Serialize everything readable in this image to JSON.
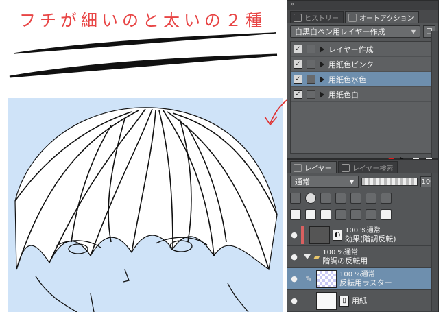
{
  "annotation": {
    "note": "フチが細いのと太いの２種"
  },
  "colors": {
    "panel_bg": "#545658",
    "selection": "#6e8fae",
    "canvas_bg": "#cfe3f8",
    "annotation_red": "#e84545",
    "record_red": "#e01818"
  },
  "auto_action": {
    "tabs": [
      {
        "label": "ヒストリー",
        "active": false,
        "icon": "history-icon"
      },
      {
        "label": "オートアクション",
        "active": true,
        "icon": "auto-action-icon"
      }
    ],
    "set_name": "白黒白ペン用レイヤー作成",
    "items": [
      {
        "label": "レイヤー作成",
        "checked": true,
        "selected": false
      },
      {
        "label": "用紙色ピンク",
        "checked": true,
        "selected": false
      },
      {
        "label": "用紙色水色",
        "checked": true,
        "selected": true
      },
      {
        "label": "用紙色白",
        "checked": true,
        "selected": false
      }
    ]
  },
  "layers": {
    "tabs": [
      {
        "label": "レイヤー",
        "active": true,
        "icon": "layer-icon"
      },
      {
        "label": "レイヤー検索",
        "active": false,
        "icon": "layer-search-icon"
      }
    ],
    "blend_mode": "通常",
    "opacity": "100",
    "items": [
      {
        "percent": "100 %通常",
        "name": "効果(階調反転)",
        "thumb": "grey",
        "selected": false
      },
      {
        "percent": "100 %通常",
        "name": "階調の反転用",
        "thumb": "folder",
        "selected": false
      },
      {
        "percent": "100 %通常",
        "name": "反転用ラスター",
        "thumb": "check",
        "selected": true
      },
      {
        "percent": "",
        "name": "用紙",
        "thumb": "white",
        "selected": false
      }
    ]
  }
}
